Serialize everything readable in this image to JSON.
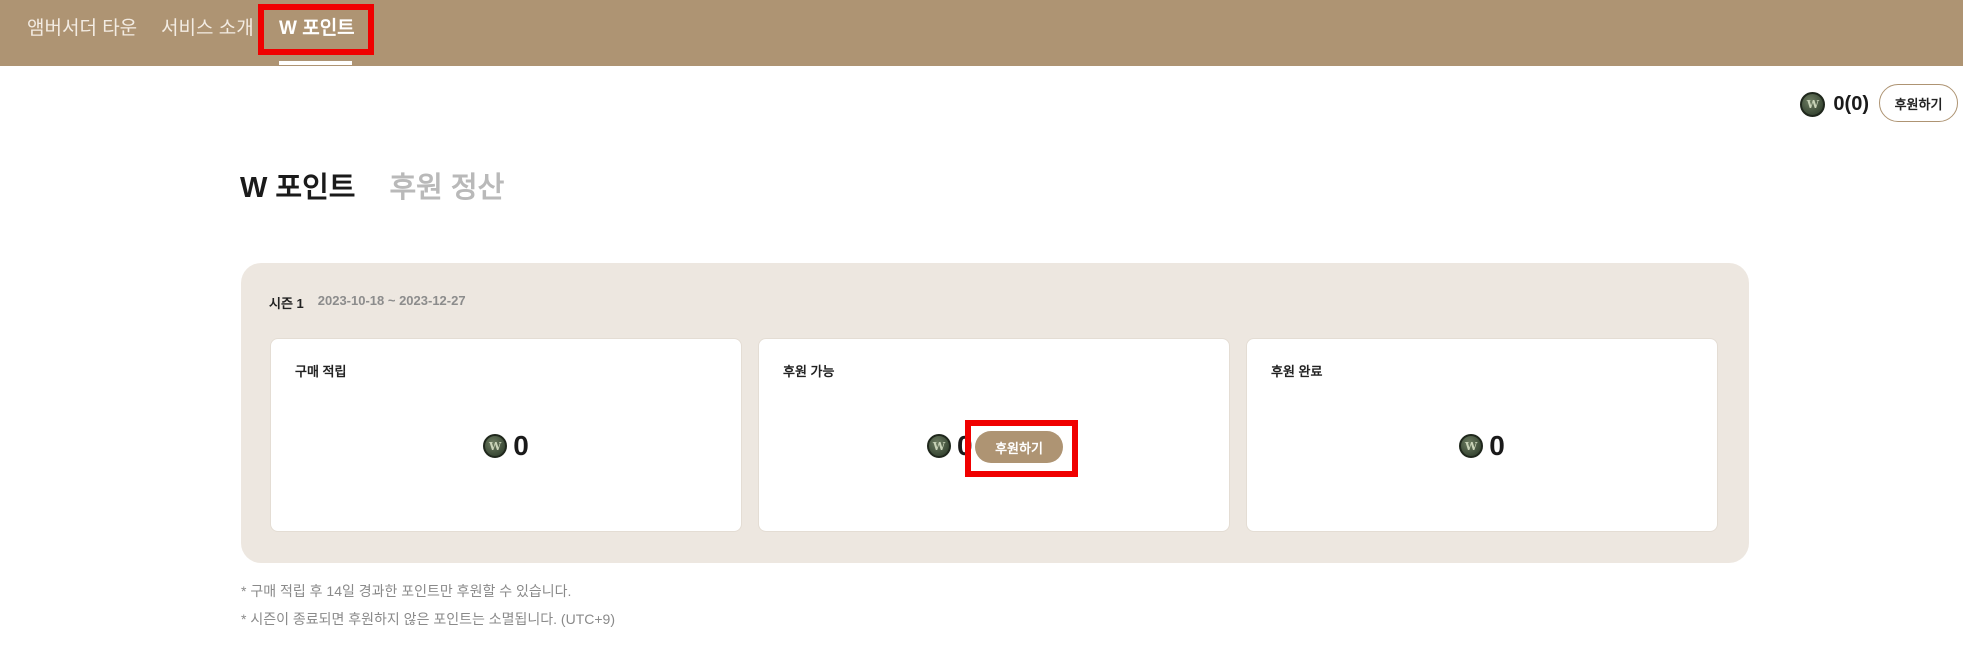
{
  "nav": {
    "items": [
      {
        "label": "앰버서더 타운"
      },
      {
        "label": "서비스 소개"
      },
      {
        "label": "W 포인트"
      }
    ]
  },
  "balance": {
    "coin_icon": "w-coin-icon",
    "amount": "0(0)",
    "button_label": "후원하기"
  },
  "tabs": [
    {
      "label": "W 포인트",
      "active": true
    },
    {
      "label": "후원 정산",
      "active": false
    }
  ],
  "season": {
    "name": "시즌 1",
    "dates": "2023-10-18 ~ 2023-12-27"
  },
  "cards": [
    {
      "title": "구매 적립",
      "value": "0"
    },
    {
      "title": "후원 가능",
      "value": "0",
      "button_label": "후원하기"
    },
    {
      "title": "후원 완료",
      "value": "0"
    }
  ],
  "notes": [
    "* 구매 적립 후 14일 경과한 포인트만 후원할 수 있습니다.",
    "* 시즌이 종료되면 후원하지 않은 포인트는 소멸됩니다. (UTC+9)"
  ],
  "colors": {
    "brand": "#ae9473",
    "panel_bg": "#ede7e0",
    "highlight": "#f00000"
  }
}
